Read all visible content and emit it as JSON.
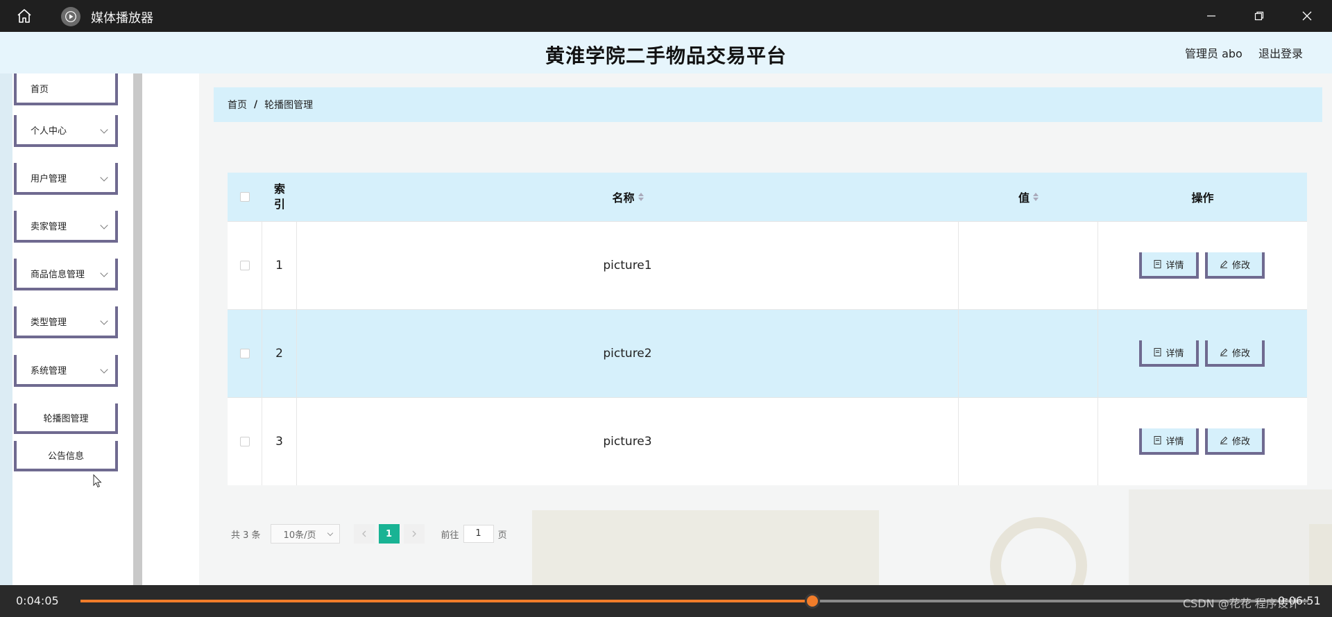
{
  "player": {
    "title": "媒体播放器",
    "current_time": "0:04:05",
    "total_time": "0:06:51",
    "progress": 0.596,
    "watermark": "CSDN @花花 程序设计",
    "accent_color": "#f07c2a",
    "icons": [
      "home-icon",
      "play-icon",
      "minimize-icon",
      "maximize-icon",
      "close-icon"
    ]
  },
  "site": {
    "title": "黄淮学院二手物品交易平台",
    "admin_label": "管理员 abo",
    "logout": "退出登录"
  },
  "sidebar": {
    "items": [
      {
        "label": "首页",
        "has_dropdown": false
      },
      {
        "label": "个人中心",
        "has_dropdown": true
      },
      {
        "label": "用户管理",
        "has_dropdown": true
      },
      {
        "label": "卖家管理",
        "has_dropdown": true
      },
      {
        "label": "商品信息管理",
        "has_dropdown": true
      },
      {
        "label": "类型管理",
        "has_dropdown": true
      },
      {
        "label": "系统管理",
        "has_dropdown": true
      },
      {
        "label": "轮播图管理",
        "has_dropdown": false
      },
      {
        "label": "公告信息",
        "has_dropdown": false
      }
    ]
  },
  "breadcrumb": {
    "home": "首页",
    "separator": "/",
    "current": "轮播图管理"
  },
  "table": {
    "headers": {
      "index_line1": "索",
      "index_line2": "引",
      "name": "名称",
      "value": "值",
      "ops": "操作"
    },
    "rows": [
      {
        "index": "1",
        "name": "picture1",
        "value": ""
      },
      {
        "index": "2",
        "name": "picture2",
        "value": ""
      },
      {
        "index": "3",
        "name": "picture3",
        "value": ""
      }
    ],
    "detail_label": "详情",
    "edit_label": "修改"
  },
  "pagination": {
    "total": "共 3 条",
    "page_size": "10条/页",
    "current_page": "1",
    "goto_prefix": "前往",
    "goto_value": "1",
    "goto_suffix": "页",
    "accent_color": "#19b394"
  }
}
